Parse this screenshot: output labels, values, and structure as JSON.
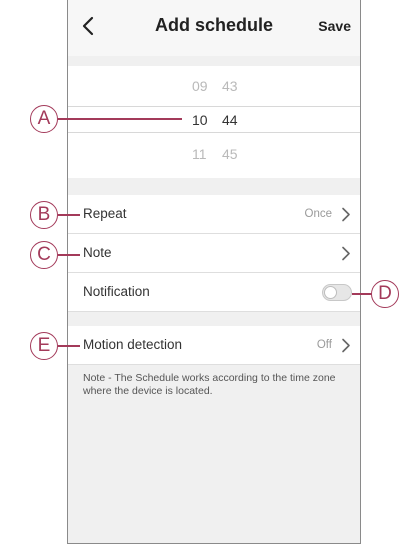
{
  "header": {
    "title": "Add schedule",
    "save_label": "Save"
  },
  "time_picker": {
    "rows": [
      {
        "hour": "09",
        "minute": "43"
      },
      {
        "hour": "10",
        "minute": "44"
      },
      {
        "hour": "11",
        "minute": "45"
      }
    ],
    "selected_index": 1
  },
  "settings": {
    "repeat": {
      "label": "Repeat",
      "value": "Once"
    },
    "note": {
      "label": "Note"
    },
    "notification": {
      "label": "Notification",
      "enabled": false
    },
    "motion": {
      "label": "Motion detection",
      "value": "Off"
    }
  },
  "footer_note": "Note - The Schedule works according to the time zone where the device is located.",
  "callouts": {
    "a": "A",
    "b": "B",
    "c": "C",
    "d": "D",
    "e": "E"
  },
  "colors": {
    "callout": "#a33a5a",
    "background": "#f0f0f0"
  },
  "icons": {
    "back": "chevron-left-icon",
    "chevron": "chevron-right-icon"
  }
}
